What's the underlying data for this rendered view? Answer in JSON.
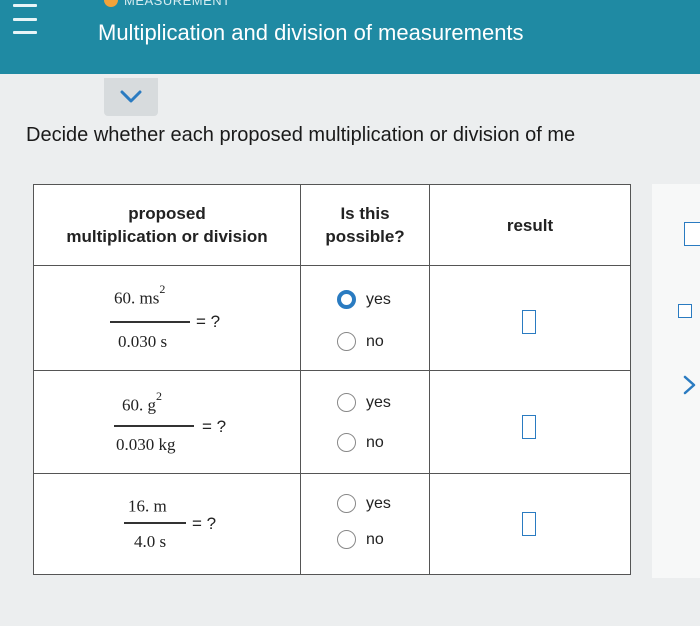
{
  "header": {
    "section_label": "MEASUREMENT",
    "title": "Multiplication and division of measurements",
    "accent_color": "#1f8aa3",
    "section_dot_color": "#f2a33a"
  },
  "icons": {
    "menu": "hamburger-menu-icon",
    "collapse": "chevron-down-icon",
    "next": "chevron-right-icon"
  },
  "instructions": "Decide whether each proposed multiplication or division of me",
  "table": {
    "headers": {
      "proposed_line1": "proposed",
      "proposed_line2": "multiplication or division",
      "possible_line1": "Is this",
      "possible_line2": "possible?",
      "result": "result"
    },
    "rows": [
      {
        "numerator": "60. ms",
        "numerator_exp": "2",
        "denominator": "0.030 s",
        "equals": "= ?",
        "options": [
          "yes",
          "no"
        ],
        "selected": "yes"
      },
      {
        "numerator": "60. g",
        "numerator_exp": "2",
        "denominator": "0.030 kg",
        "equals": "= ?",
        "options": [
          "yes",
          "no"
        ],
        "selected": ""
      },
      {
        "numerator": "16. m",
        "numerator_exp": "",
        "denominator": "4.0 s",
        "equals": "= ?",
        "options": [
          "yes",
          "no"
        ],
        "selected": ""
      }
    ]
  }
}
